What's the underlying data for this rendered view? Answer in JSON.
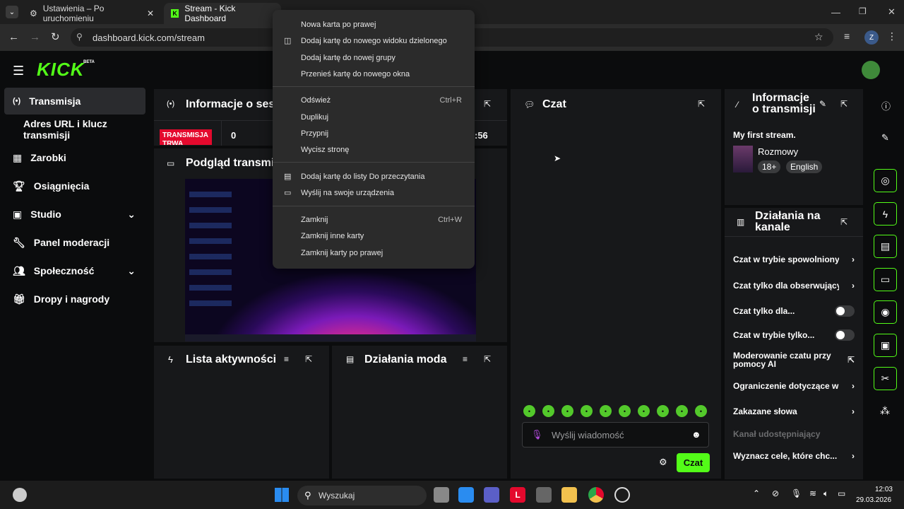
{
  "browser": {
    "tabs": [
      {
        "label": "Ustawienia – Po uruchomieniu"
      },
      {
        "label": "Stream - Kick Dashboard"
      }
    ],
    "url": "dashboard.kick.com/stream",
    "profile_initial": "Z"
  },
  "kick": {
    "logo": "KICK",
    "beta": "BETA",
    "nav": [
      {
        "label": "Transmisja"
      },
      {
        "label": "Adres URL i klucz transmisji"
      },
      {
        "label": "Zarobki"
      },
      {
        "label": "Osiągnięcia"
      },
      {
        "label": "Studio"
      },
      {
        "label": "Panel moderacji"
      },
      {
        "label": "Społeczność"
      },
      {
        "label": "Dropy i nagrody"
      }
    ],
    "session": {
      "title": "Informacje o sesji",
      "live_badge": "TRANSMISJA TRWA",
      "viewers": "0",
      "time": ":56"
    },
    "preview": {
      "title": "Podgląd transmisji"
    },
    "activity": {
      "title": "Lista aktywności"
    },
    "mod_actions": {
      "title": "Działania moda"
    },
    "chat": {
      "title": "Czat",
      "placeholder": "Wyślij wiadomość",
      "send_label": "Czat"
    },
    "stream_info": {
      "title": "Informacje o transmisji",
      "stream_title": "My first stream.",
      "category": "Rozmowy",
      "tag_age": "18+",
      "tag_lang": "English"
    },
    "channel_actions": {
      "title": "Działania na kanale",
      "items": [
        {
          "label": "Czat w trybie spowolnionym"
        },
        {
          "label": "Czat tylko dla obserwujących"
        },
        {
          "label": "Czat tylko dla..."
        },
        {
          "label": "Czat w trybie tylko..."
        },
        {
          "label": "Moderowanie czatu przy pomocy AI"
        },
        {
          "label": "Ograniczenie dotyczące wi"
        },
        {
          "label": "Zakazane słowa"
        },
        {
          "label": "Kanał udostępniający"
        },
        {
          "label": "Wyznacz cele, które chc..."
        }
      ]
    }
  },
  "context_menu": {
    "items": [
      {
        "label": "Nowa karta po prawej",
        "shortcut": ""
      },
      {
        "label": "Dodaj kartę do nowego widoku dzielonego",
        "shortcut": ""
      },
      {
        "label": "Dodaj kartę do nowej grupy",
        "shortcut": ""
      },
      {
        "label": "Przenieś kartę do nowego okna",
        "shortcut": ""
      },
      {
        "label": "Odśwież",
        "shortcut": "Ctrl+R"
      },
      {
        "label": "Duplikuj",
        "shortcut": ""
      },
      {
        "label": "Przypnij",
        "shortcut": ""
      },
      {
        "label": "Wycisz stronę",
        "shortcut": ""
      },
      {
        "label": "Dodaj kartę do listy Do przeczytania",
        "shortcut": ""
      },
      {
        "label": "Wyślij na swoje urządzenia",
        "shortcut": ""
      },
      {
        "label": "Zamknij",
        "shortcut": "Ctrl+W"
      },
      {
        "label": "Zamknij inne karty",
        "shortcut": ""
      },
      {
        "label": "Zamknij karty po prawej",
        "shortcut": ""
      }
    ]
  },
  "taskbar": {
    "search_placeholder": "Wyszukaj",
    "time": "12:03",
    "date": "29.03.2026"
  },
  "colors": {
    "accent": "#53fc18",
    "live": "#e4092d",
    "panel": "#17181a"
  }
}
